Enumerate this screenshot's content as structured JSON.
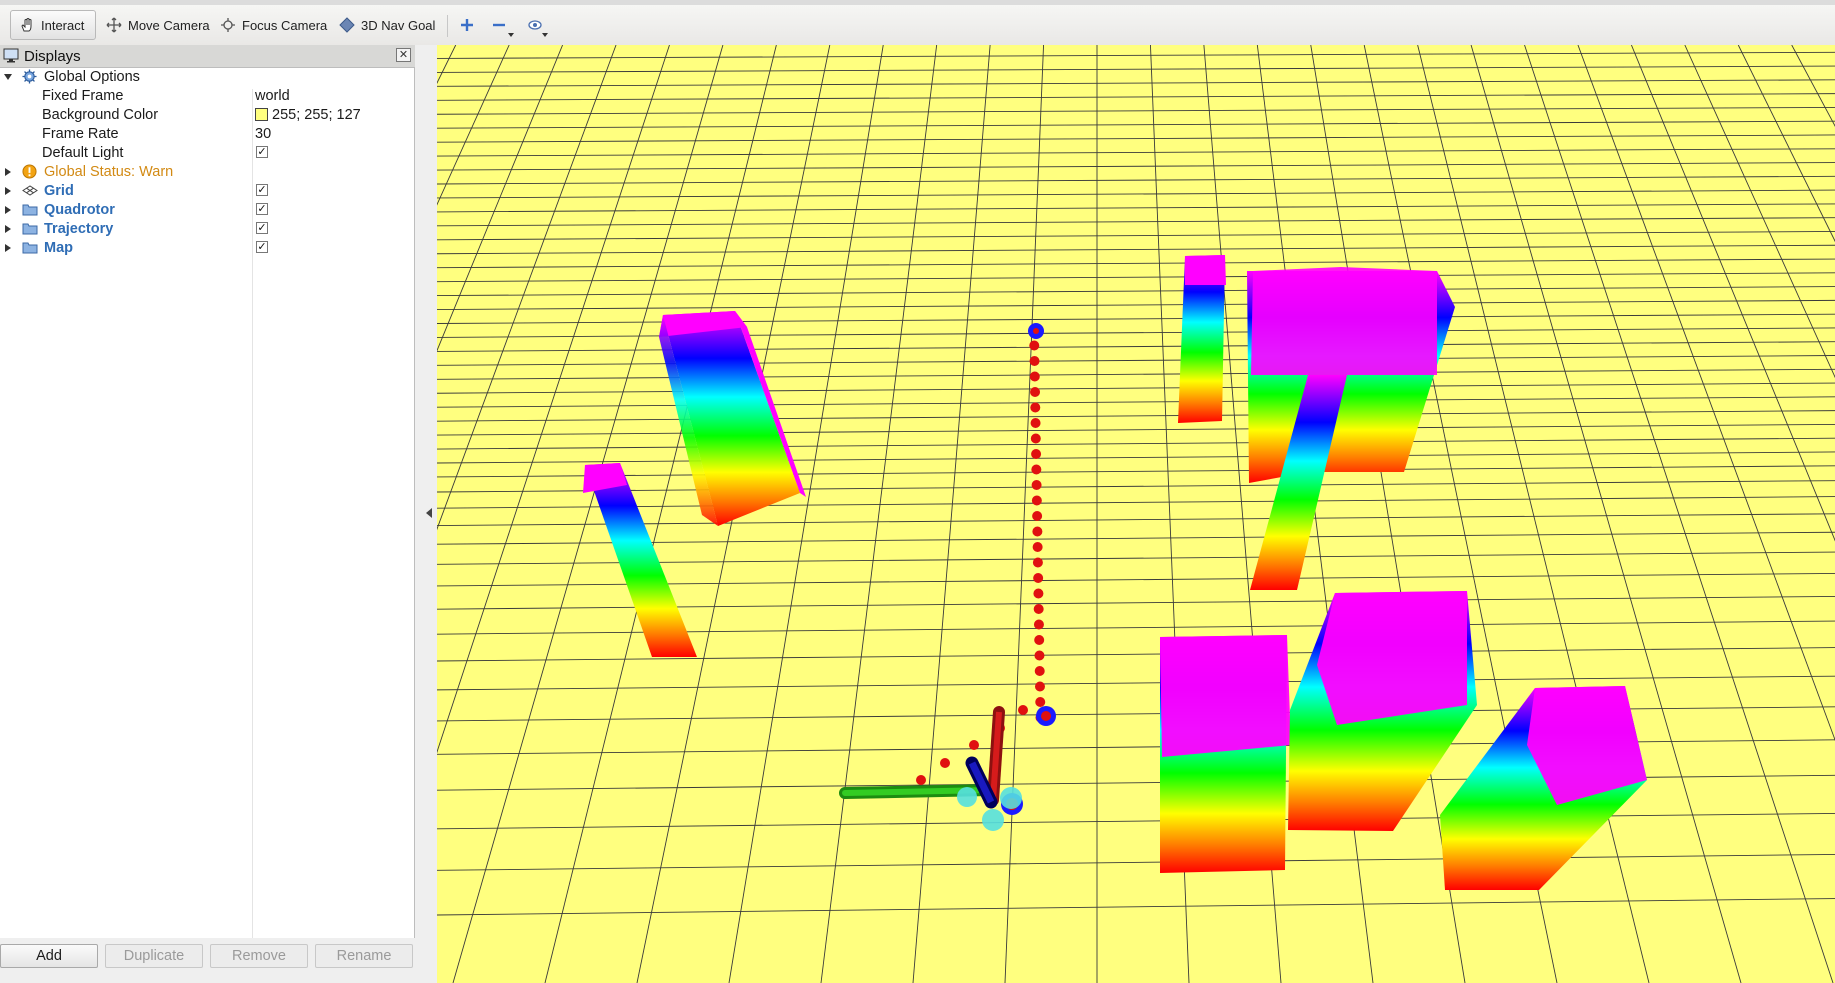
{
  "toolbar": {
    "interact": "Interact",
    "move_camera": "Move Camera",
    "focus_camera": "Focus Camera",
    "nav_goal": "3D Nav Goal",
    "icons": [
      "hand-icon",
      "move-camera-icon",
      "focus-camera-icon",
      "nav-goal-icon",
      "plus-icon",
      "minus-icon",
      "eye-icon"
    ]
  },
  "displays": {
    "title": "Displays",
    "global_options": "Global Options",
    "props": [
      {
        "label": "Fixed Frame",
        "value": "world"
      },
      {
        "label": "Background Color",
        "value": "255; 255; 127"
      },
      {
        "label": "Frame Rate",
        "value": "30"
      },
      {
        "label": "Default Light",
        "value": "✓"
      }
    ],
    "status": "Global Status: Warn",
    "items": [
      {
        "label": "Grid",
        "checked": "✓"
      },
      {
        "label": "Quadrotor",
        "checked": "✓"
      },
      {
        "label": "Trajectory",
        "checked": "✓"
      },
      {
        "label": "Map",
        "checked": "✓"
      }
    ],
    "buttons": {
      "add": "Add",
      "duplicate": "Duplicate",
      "remove": "Remove",
      "rename": "Rename"
    }
  },
  "viewport": {
    "background": "#ffff7f",
    "grid_color": "#3a3a3a",
    "trajectory_color": "#e01010",
    "waypoint_color": "#1a1aff",
    "obstacle_colormap": [
      "#ff0000",
      "#ff7f00",
      "#ffff00",
      "#00ff00",
      "#00ffff",
      "#0000ff",
      "#ff00ff"
    ]
  }
}
